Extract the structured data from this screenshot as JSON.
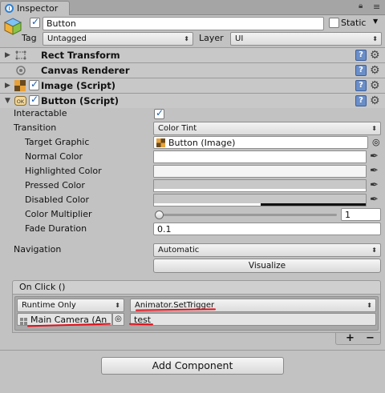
{
  "tab": {
    "title": "Inspector",
    "lock_icon": "lock-icon",
    "menu_icon": "menu-icon"
  },
  "gameobject": {
    "name": "Button",
    "active": true,
    "static_label": "Static",
    "static_checked": false,
    "tag_label": "Tag",
    "tag_value": "Untagged",
    "layer_label": "Layer",
    "layer_value": "UI"
  },
  "components": [
    {
      "title": "Rect Transform",
      "icon": "rect-transform-icon",
      "has_checkbox": false,
      "expanded": false
    },
    {
      "title": "Canvas Renderer",
      "icon": "canvas-renderer-icon",
      "has_checkbox": false,
      "expanded": false
    },
    {
      "title": "Image (Script)",
      "icon": "image-script-icon",
      "has_checkbox": true,
      "checked": true,
      "expanded": false
    },
    {
      "title": "Button (Script)",
      "icon": "button-script-icon",
      "has_checkbox": true,
      "checked": true,
      "expanded": true
    }
  ],
  "button_script": {
    "interactable_label": "Interactable",
    "interactable": true,
    "transition_label": "Transition",
    "transition_value": "Color Tint",
    "target_graphic_label": "Target Graphic",
    "target_graphic_value": "Button (Image)",
    "normal_color_label": "Normal Color",
    "highlighted_color_label": "Highlighted Color",
    "pressed_color_label": "Pressed Color",
    "disabled_color_label": "Disabled Color",
    "colors": {
      "normal": "#ffffff",
      "highlighted": "#f5f5f5",
      "pressed": "#c8c8c8",
      "disabled": "#c8c8c8"
    },
    "color_multiplier_label": "Color Multiplier",
    "color_multiplier_value": "1",
    "color_multiplier_fraction": 0.0,
    "fade_duration_label": "Fade Duration",
    "fade_duration_value": "0.1",
    "navigation_label": "Navigation",
    "navigation_value": "Automatic",
    "visualize_label": "Visualize"
  },
  "on_click": {
    "header": "On Click ()",
    "runtime_value": "Runtime Only",
    "function_value": "Animator.SetTrigger",
    "object_value": "Main Camera (An",
    "argument_value": "test",
    "plus_label": "+",
    "minus_label": "−"
  },
  "add_component_label": "Add Component",
  "accent": {
    "annotation_red": "#e0101a",
    "help_blue": "#6a8ec8"
  }
}
